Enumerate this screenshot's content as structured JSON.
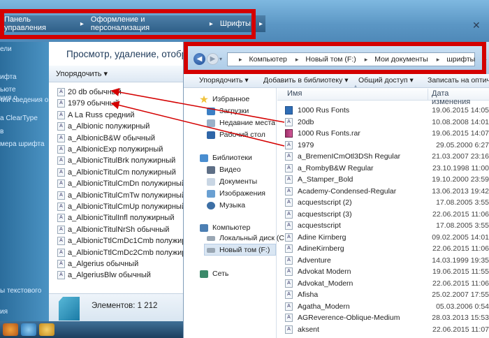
{
  "back_window": {
    "breadcrumb": [
      "Панель управления",
      "Оформление и персонализация",
      "Шрифты"
    ],
    "title": "Просмотр, удаление, отображ",
    "toolbar": {
      "organize": "Упорядочить"
    },
    "left_links": [
      "ели",
      "ифта",
      "ьюте",
      "ния о",
      "нии сведения о",
      "а ClearType",
      "в",
      "мера шрифта",
      "ы текстового",
      "ия"
    ],
    "fonts": [
      "20 db обычный",
      "1979 обычный",
      "A La Russ средний",
      "a_Albionic полужирный",
      "a_AlbionicB&W обычный",
      "a_AlbionicExp полужирный",
      "a_AlbionicTitulBrk полужирный",
      "a_AlbionicTitulCm полужирный",
      "a_AlbionicTitulCmDn полужирный",
      "a_AlbionicTitulCmTw полужирный",
      "a_AlbionicTitulCmUp полужирный",
      "a_AlbionicTitulInfl полужирный",
      "a_AlbionicTitulNrSh обычный",
      "a_AlbionicTtlCmDc1Cmb полужирный",
      "a_AlbionicTtlCmDc2Cmb полужирный",
      "a_Algerius обычный",
      "a_AlgeriusBlw обычный"
    ],
    "status": "Элементов: 1 212"
  },
  "front_window": {
    "breadcrumb": [
      "Компьютер",
      "Новый том (F:)",
      "Мои документы",
      "шрифты"
    ],
    "toolbar": {
      "organize": "Упорядочить",
      "add_library": "Добавить в библиотеку",
      "share": "Общий доступ",
      "burn": "Записать на оптиче"
    },
    "nav": {
      "favorites": "Избранное",
      "downloads": "Загрузки",
      "recent": "Недавние места",
      "desktop": "Рабочий стол",
      "libraries": "Библиотеки",
      "video": "Видео",
      "documents": "Документы",
      "images": "Изображения",
      "music": "Музыка",
      "computer": "Компьютер",
      "local_disk": "Локальный диск (C",
      "new_volume": "Новый том (F:)",
      "network": "Сеть"
    },
    "columns": {
      "name": "Имя",
      "date": "Дата изменения"
    },
    "files": [
      {
        "name": "1000 Rus Fonts",
        "date": "19.06.2015 14:05",
        "type": "folder"
      },
      {
        "name": "20db",
        "date": "10.08.2008 14:01",
        "type": "font"
      },
      {
        "name": "1000 Rus Fonts.rar",
        "date": "19.06.2015 14:07",
        "type": "rar"
      },
      {
        "name": "1979",
        "date": "29.05.2000 6:27",
        "type": "font"
      },
      {
        "name": "a_BremenICmOtl3DSh Regular",
        "date": "21.03.2007 23:16",
        "type": "font"
      },
      {
        "name": "a_RombyB&W Regular",
        "date": "23.10.1998 11:00",
        "type": "font"
      },
      {
        "name": "A_Stamper_Bold",
        "date": "19.10.2000 23:59",
        "type": "font"
      },
      {
        "name": "Academy-Condensed-Regular",
        "date": "13.06.2013 19:42",
        "type": "font"
      },
      {
        "name": "acquestscript (2)",
        "date": "17.08.2005 3:55",
        "type": "font"
      },
      {
        "name": "acquestscript (3)",
        "date": "22.06.2015 11:06",
        "type": "font"
      },
      {
        "name": "acquestscript",
        "date": "17.08.2005 3:55",
        "type": "font"
      },
      {
        "name": "Adine Kirnberg",
        "date": "09.02.2005 14:01",
        "type": "font"
      },
      {
        "name": "AdineKirnberg",
        "date": "22.06.2015 11:06",
        "type": "font"
      },
      {
        "name": "Adventure",
        "date": "14.03.1999 19:35",
        "type": "font"
      },
      {
        "name": "Advokat Modern",
        "date": "19.06.2015 11:55",
        "type": "font"
      },
      {
        "name": "Advokat_Modern",
        "date": "22.06.2015 11:06",
        "type": "font"
      },
      {
        "name": "Afisha",
        "date": "25.02.2007 17:55",
        "type": "font"
      },
      {
        "name": "Agatha_Modern",
        "date": "05.03.2006 0:54",
        "type": "font"
      },
      {
        "name": "AGReverence-Oblique-Medium",
        "date": "28.03.2013 15:53",
        "type": "font"
      },
      {
        "name": "aksent",
        "date": "22.06.2015 11:07",
        "type": "font"
      }
    ]
  },
  "colors": {
    "annotation_red": "#d40000",
    "selection": "#d9e6f3"
  }
}
